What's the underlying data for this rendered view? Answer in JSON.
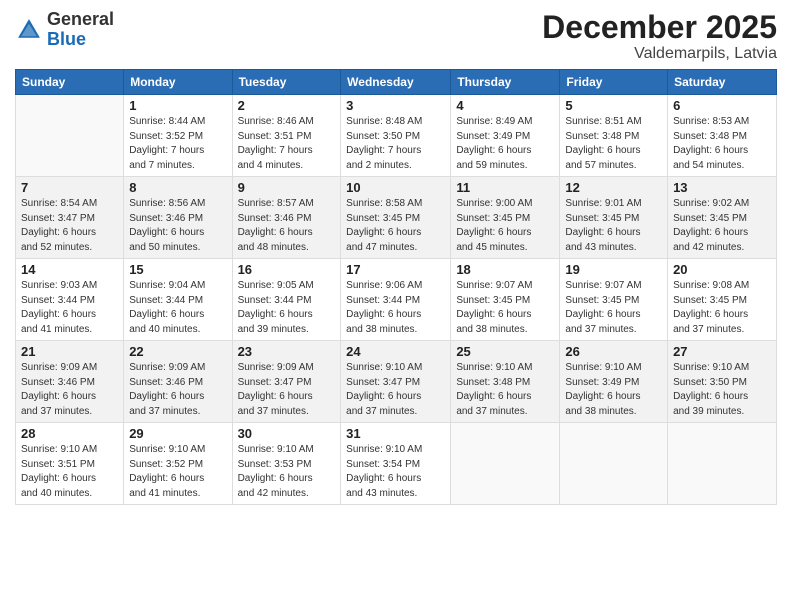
{
  "logo": {
    "general": "General",
    "blue": "Blue"
  },
  "title": "December 2025",
  "location": "Valdemarpils, Latvia",
  "days_header": [
    "Sunday",
    "Monday",
    "Tuesday",
    "Wednesday",
    "Thursday",
    "Friday",
    "Saturday"
  ],
  "weeks": [
    [
      {
        "num": "",
        "info": ""
      },
      {
        "num": "1",
        "info": "Sunrise: 8:44 AM\nSunset: 3:52 PM\nDaylight: 7 hours\nand 7 minutes."
      },
      {
        "num": "2",
        "info": "Sunrise: 8:46 AM\nSunset: 3:51 PM\nDaylight: 7 hours\nand 4 minutes."
      },
      {
        "num": "3",
        "info": "Sunrise: 8:48 AM\nSunset: 3:50 PM\nDaylight: 7 hours\nand 2 minutes."
      },
      {
        "num": "4",
        "info": "Sunrise: 8:49 AM\nSunset: 3:49 PM\nDaylight: 6 hours\nand 59 minutes."
      },
      {
        "num": "5",
        "info": "Sunrise: 8:51 AM\nSunset: 3:48 PM\nDaylight: 6 hours\nand 57 minutes."
      },
      {
        "num": "6",
        "info": "Sunrise: 8:53 AM\nSunset: 3:48 PM\nDaylight: 6 hours\nand 54 minutes."
      }
    ],
    [
      {
        "num": "7",
        "info": "Sunrise: 8:54 AM\nSunset: 3:47 PM\nDaylight: 6 hours\nand 52 minutes."
      },
      {
        "num": "8",
        "info": "Sunrise: 8:56 AM\nSunset: 3:46 PM\nDaylight: 6 hours\nand 50 minutes."
      },
      {
        "num": "9",
        "info": "Sunrise: 8:57 AM\nSunset: 3:46 PM\nDaylight: 6 hours\nand 48 minutes."
      },
      {
        "num": "10",
        "info": "Sunrise: 8:58 AM\nSunset: 3:45 PM\nDaylight: 6 hours\nand 47 minutes."
      },
      {
        "num": "11",
        "info": "Sunrise: 9:00 AM\nSunset: 3:45 PM\nDaylight: 6 hours\nand 45 minutes."
      },
      {
        "num": "12",
        "info": "Sunrise: 9:01 AM\nSunset: 3:45 PM\nDaylight: 6 hours\nand 43 minutes."
      },
      {
        "num": "13",
        "info": "Sunrise: 9:02 AM\nSunset: 3:45 PM\nDaylight: 6 hours\nand 42 minutes."
      }
    ],
    [
      {
        "num": "14",
        "info": "Sunrise: 9:03 AM\nSunset: 3:44 PM\nDaylight: 6 hours\nand 41 minutes."
      },
      {
        "num": "15",
        "info": "Sunrise: 9:04 AM\nSunset: 3:44 PM\nDaylight: 6 hours\nand 40 minutes."
      },
      {
        "num": "16",
        "info": "Sunrise: 9:05 AM\nSunset: 3:44 PM\nDaylight: 6 hours\nand 39 minutes."
      },
      {
        "num": "17",
        "info": "Sunrise: 9:06 AM\nSunset: 3:44 PM\nDaylight: 6 hours\nand 38 minutes."
      },
      {
        "num": "18",
        "info": "Sunrise: 9:07 AM\nSunset: 3:45 PM\nDaylight: 6 hours\nand 38 minutes."
      },
      {
        "num": "19",
        "info": "Sunrise: 9:07 AM\nSunset: 3:45 PM\nDaylight: 6 hours\nand 37 minutes."
      },
      {
        "num": "20",
        "info": "Sunrise: 9:08 AM\nSunset: 3:45 PM\nDaylight: 6 hours\nand 37 minutes."
      }
    ],
    [
      {
        "num": "21",
        "info": "Sunrise: 9:09 AM\nSunset: 3:46 PM\nDaylight: 6 hours\nand 37 minutes."
      },
      {
        "num": "22",
        "info": "Sunrise: 9:09 AM\nSunset: 3:46 PM\nDaylight: 6 hours\nand 37 minutes."
      },
      {
        "num": "23",
        "info": "Sunrise: 9:09 AM\nSunset: 3:47 PM\nDaylight: 6 hours\nand 37 minutes."
      },
      {
        "num": "24",
        "info": "Sunrise: 9:10 AM\nSunset: 3:47 PM\nDaylight: 6 hours\nand 37 minutes."
      },
      {
        "num": "25",
        "info": "Sunrise: 9:10 AM\nSunset: 3:48 PM\nDaylight: 6 hours\nand 37 minutes."
      },
      {
        "num": "26",
        "info": "Sunrise: 9:10 AM\nSunset: 3:49 PM\nDaylight: 6 hours\nand 38 minutes."
      },
      {
        "num": "27",
        "info": "Sunrise: 9:10 AM\nSunset: 3:50 PM\nDaylight: 6 hours\nand 39 minutes."
      }
    ],
    [
      {
        "num": "28",
        "info": "Sunrise: 9:10 AM\nSunset: 3:51 PM\nDaylight: 6 hours\nand 40 minutes."
      },
      {
        "num": "29",
        "info": "Sunrise: 9:10 AM\nSunset: 3:52 PM\nDaylight: 6 hours\nand 41 minutes."
      },
      {
        "num": "30",
        "info": "Sunrise: 9:10 AM\nSunset: 3:53 PM\nDaylight: 6 hours\nand 42 minutes."
      },
      {
        "num": "31",
        "info": "Sunrise: 9:10 AM\nSunset: 3:54 PM\nDaylight: 6 hours\nand 43 minutes."
      },
      {
        "num": "",
        "info": ""
      },
      {
        "num": "",
        "info": ""
      },
      {
        "num": "",
        "info": ""
      }
    ]
  ]
}
